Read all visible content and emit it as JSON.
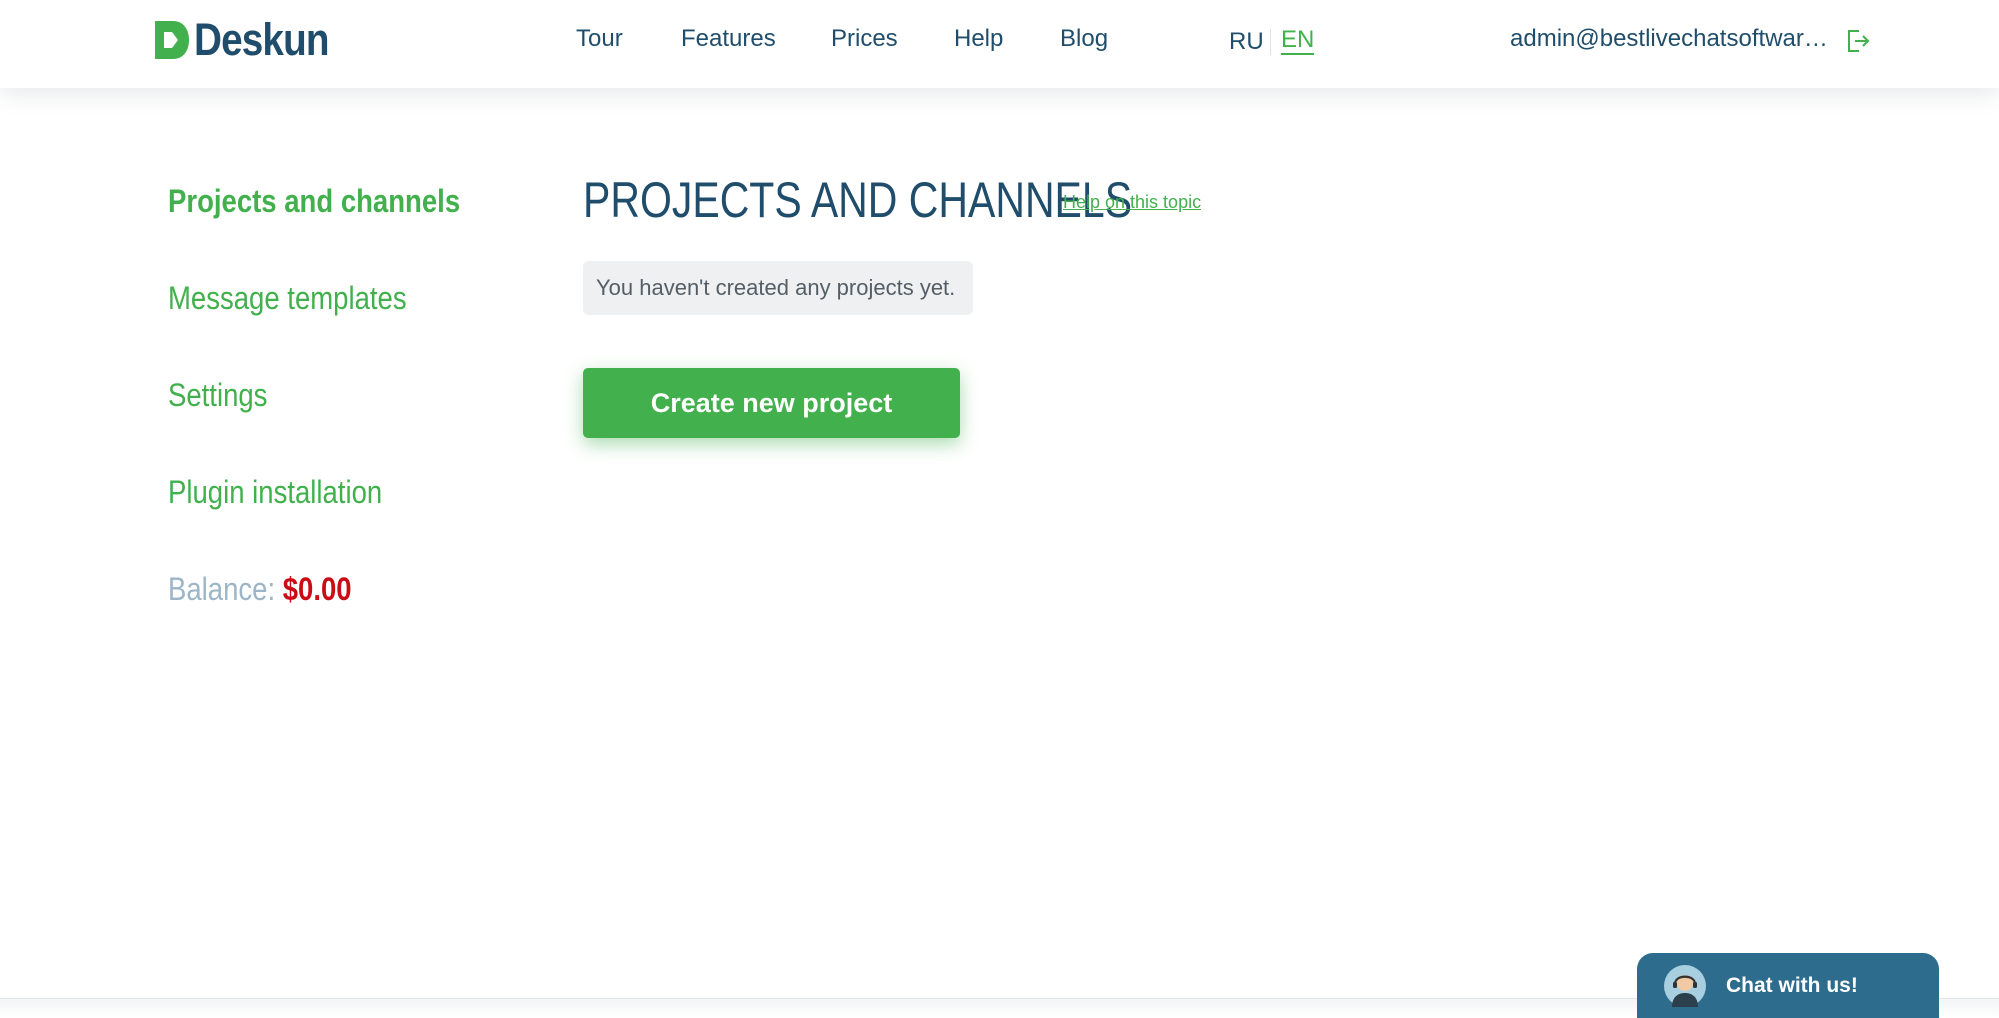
{
  "header": {
    "logo_text": "Deskun",
    "nav": [
      {
        "label": "Tour"
      },
      {
        "label": "Features"
      },
      {
        "label": "Prices"
      },
      {
        "label": "Help"
      },
      {
        "label": "Blog"
      }
    ],
    "languages": [
      {
        "code": "RU",
        "active": false
      },
      {
        "code": "EN",
        "active": true
      }
    ],
    "user_email": "admin@bestlivechatsoftwar…",
    "logout_icon": "logout-icon"
  },
  "sidebar": {
    "items": [
      {
        "label": "Projects and channels",
        "active": true
      },
      {
        "label": "Message templates",
        "active": false
      },
      {
        "label": "Settings",
        "active": false
      },
      {
        "label": "Plugin installation",
        "active": false
      }
    ],
    "balance_label": "Balance:",
    "balance_value": "$0.00"
  },
  "main": {
    "title": "PROJECTS AND CHANNELS",
    "help_link": "Help on this topic",
    "empty_message": "You haven't created any projects yet.",
    "create_button": "Create new project"
  },
  "chat_widget": {
    "label": "Chat with us!",
    "avatar_icon": "support-agent-icon"
  },
  "colors": {
    "brand_green": "#42b04d",
    "navy": "#1f4d6b",
    "balance_red": "#c80d14",
    "chat_blue": "#2e6c8e"
  }
}
